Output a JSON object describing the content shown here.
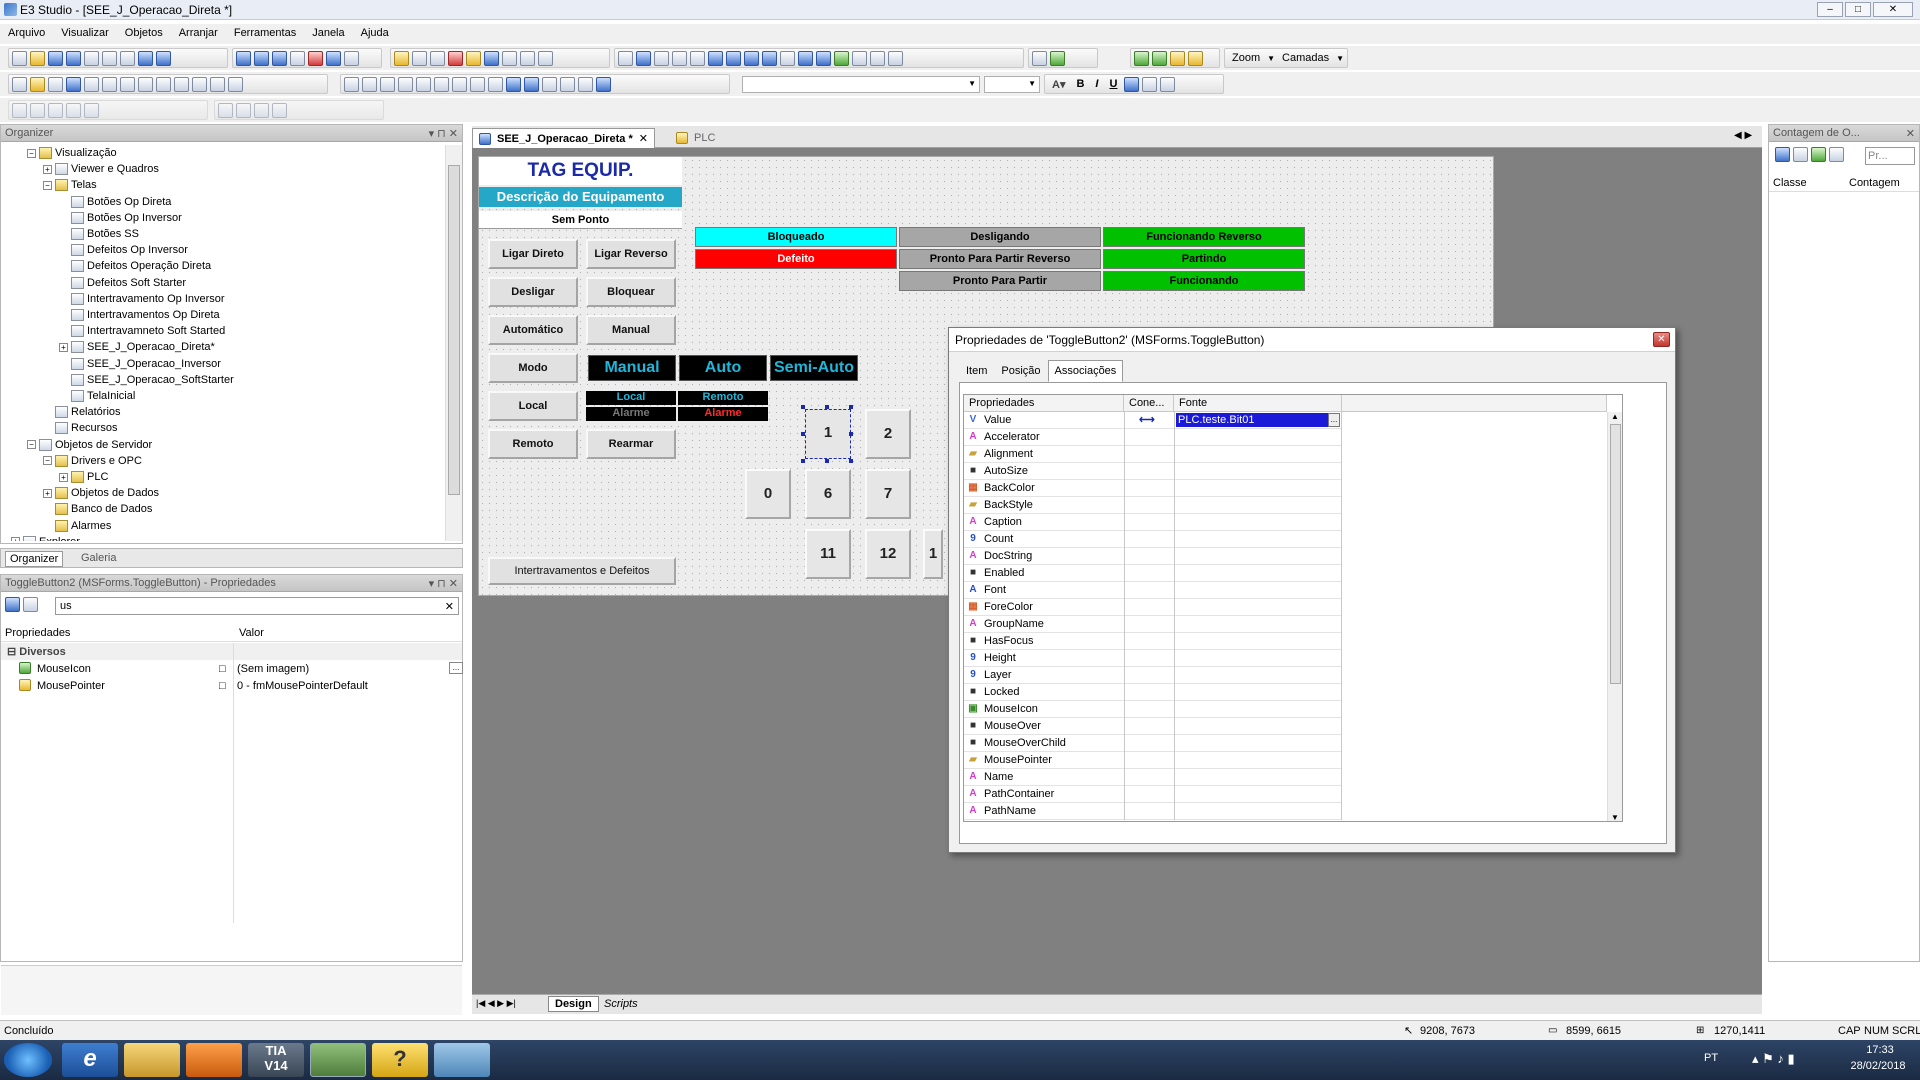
{
  "window": {
    "title": "E3 Studio - [SEE_J_Operacao_Direta *]"
  },
  "menu": [
    "Arquivo",
    "Visualizar",
    "Objetos",
    "Arranjar",
    "Ferramentas",
    "Janela",
    "Ajuda"
  ],
  "toolbar": {
    "zoom_label": "Zoom",
    "layers_label": "Camadas"
  },
  "organizer": {
    "title": "Organizer",
    "items": [
      {
        "label": "Visualização",
        "level": 1,
        "icon": "folder-icon",
        "exp": "−"
      },
      {
        "label": "Viewer e Quadros",
        "level": 2,
        "icon": "viewer-icon",
        "exp": "+"
      },
      {
        "label": "Telas",
        "level": 2,
        "icon": "folder-icon",
        "exp": "−"
      },
      {
        "label": "Botões Op Direta",
        "level": 3,
        "icon": "screen-icon",
        "exp": ""
      },
      {
        "label": "Botões Op Inversor",
        "level": 3,
        "icon": "screen-icon",
        "exp": ""
      },
      {
        "label": "Botões SS",
        "level": 3,
        "icon": "screen-icon",
        "exp": ""
      },
      {
        "label": "Defeitos Op Inversor",
        "level": 3,
        "icon": "screen-icon",
        "exp": ""
      },
      {
        "label": "Defeitos Operação Direta",
        "level": 3,
        "icon": "screen-icon",
        "exp": ""
      },
      {
        "label": "Defeitos Soft Starter",
        "level": 3,
        "icon": "screen-icon",
        "exp": ""
      },
      {
        "label": "Intertravamento Op Inversor",
        "level": 3,
        "icon": "screen-icon",
        "exp": ""
      },
      {
        "label": "Intertravamentos Op Direta",
        "level": 3,
        "icon": "screen-icon",
        "exp": ""
      },
      {
        "label": "Intertravamneto Soft Started",
        "level": 3,
        "icon": "screen-icon",
        "exp": ""
      },
      {
        "label": "SEE_J_Operacao_Direta*",
        "level": 3,
        "icon": "screen-icon",
        "exp": "+"
      },
      {
        "label": "SEE_J_Operacao_Inversor",
        "level": 3,
        "icon": "screen-icon",
        "exp": ""
      },
      {
        "label": "SEE_J_Operacao_SoftStarter",
        "level": 3,
        "icon": "screen-icon",
        "exp": ""
      },
      {
        "label": "TelaInicial",
        "level": 3,
        "icon": "screen-icon",
        "exp": ""
      },
      {
        "label": "Relatórios",
        "level": 2,
        "icon": "report-icon",
        "exp": ""
      },
      {
        "label": "Recursos",
        "level": 2,
        "icon": "resource-icon",
        "exp": ""
      },
      {
        "label": "Objetos de Servidor",
        "level": 1,
        "icon": "server-icon",
        "exp": "−"
      },
      {
        "label": "Drivers e OPC",
        "level": 2,
        "icon": "folder-icon",
        "exp": "−"
      },
      {
        "label": "PLC",
        "level": 3,
        "icon": "plc-icon",
        "exp": "+"
      },
      {
        "label": "Objetos de Dados",
        "level": 2,
        "icon": "folder-icon",
        "exp": "+"
      },
      {
        "label": "Banco de Dados",
        "level": 2,
        "icon": "database-icon",
        "exp": ""
      },
      {
        "label": "Alarmes",
        "level": 2,
        "icon": "alarm-icon",
        "exp": ""
      },
      {
        "label": "Explorer",
        "level": 0,
        "icon": "explorer-icon",
        "exp": "+"
      }
    ],
    "tabs": [
      "Organizer",
      "Galeria"
    ]
  },
  "props_panel": {
    "title": "ToggleButton2 (MSForms.ToggleButton) - Propriedades",
    "search_value": "us",
    "col_prop": "Propriedades",
    "col_value": "Valor",
    "group": "Diversos",
    "rows": [
      {
        "name": "MouseIcon",
        "value": "(Sem imagem)"
      },
      {
        "name": "MousePointer",
        "value": "0 - fmMousePointerDefault"
      }
    ]
  },
  "doc_tabs": [
    {
      "label": "SEE_J_Operacao_Direta *",
      "active": true
    },
    {
      "label": "PLC",
      "active": false
    }
  ],
  "screen": {
    "tag": "TAG EQUIP.",
    "desc": "Descrição do Equipamento",
    "ponto": "Sem Ponto",
    "buttons": [
      "Ligar Direto",
      "Ligar Reverso",
      "Desligar",
      "Bloquear",
      "Automático",
      "Manual",
      "Modo",
      "Local",
      "Remoto",
      "Rearmar"
    ],
    "modes": [
      "Manual",
      "Auto",
      "Semi-Auto"
    ],
    "local_remote": [
      "Local",
      "Remoto",
      "Alarme",
      "Alarme"
    ],
    "status": [
      {
        "label": "Bloqueado",
        "color": "#00ffff"
      },
      {
        "label": "Desligando",
        "color": "#a6a6a6"
      },
      {
        "label": "Funcionando Reverso",
        "color": "#00c000"
      },
      {
        "label": "Defeito",
        "color": "#ff0000"
      },
      {
        "label": "Pronto Para Partir Reverso",
        "color": "#a6a6a6"
      },
      {
        "label": "Partindo",
        "color": "#00c000"
      },
      {
        "label": "Pronto Para Partir",
        "color": "#a6a6a6"
      },
      {
        "label": "Funcionando",
        "color": "#00c000"
      }
    ],
    "keys": [
      "1",
      "2",
      "0",
      "6",
      "7",
      "11",
      "12",
      "1"
    ],
    "interlock_btn": "Intertravamentos e Defeitos"
  },
  "dialog": {
    "title": "Propriedades de 'ToggleButton2' (MSForms.ToggleButton)",
    "tabs": [
      "Item",
      "Posição",
      "Associações"
    ],
    "active_tab": "Associações",
    "col_prop": "Propriedades",
    "col_conn": "Cone...",
    "col_src": "Fonte",
    "rows": [
      {
        "name": "Value",
        "type": "v",
        "source": "PLC.teste.Bit01",
        "linked": true
      },
      {
        "name": "Accelerator",
        "type": "A"
      },
      {
        "name": "Alignment",
        "type": "e"
      },
      {
        "name": "AutoSize",
        "type": "b"
      },
      {
        "name": "BackColor",
        "type": "c"
      },
      {
        "name": "BackStyle",
        "type": "e"
      },
      {
        "name": "Caption",
        "type": "A"
      },
      {
        "name": "Count",
        "type": "9"
      },
      {
        "name": "DocString",
        "type": "A"
      },
      {
        "name": "Enabled",
        "type": "b"
      },
      {
        "name": "Font",
        "type": "F"
      },
      {
        "name": "ForeColor",
        "type": "c"
      },
      {
        "name": "GroupName",
        "type": "A"
      },
      {
        "name": "HasFocus",
        "type": "b"
      },
      {
        "name": "Height",
        "type": "9"
      },
      {
        "name": "Layer",
        "type": "9"
      },
      {
        "name": "Locked",
        "type": "b"
      },
      {
        "name": "MouseIcon",
        "type": "i"
      },
      {
        "name": "MouseOver",
        "type": "b"
      },
      {
        "name": "MouseOverChild",
        "type": "b"
      },
      {
        "name": "MousePointer",
        "type": "e"
      },
      {
        "name": "Name",
        "type": "A"
      },
      {
        "name": "PathContainer",
        "type": "A"
      },
      {
        "name": "PathName",
        "type": "A"
      }
    ]
  },
  "design_tabs": [
    "Design",
    "Scripts"
  ],
  "right_panel": {
    "title": "Contagem de O...",
    "search_placeholder": "Pr...",
    "col_class": "Classe",
    "col_count": "Contagem"
  },
  "status_bar": {
    "left": "Concluído",
    "coord1": "9208, 7673",
    "coord2": "8599, 6615",
    "coord3": "1270,1411",
    "caps": "CAP",
    "num": "NUM",
    "scrl": "SCRL"
  },
  "taskbar": {
    "lang": "PT",
    "time": "17:33",
    "date": "28/02/2018",
    "tia": "TIA\nV14"
  }
}
